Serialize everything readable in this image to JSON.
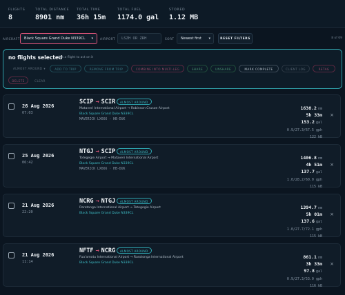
{
  "stats": [
    {
      "label": "FLIGHTS",
      "value": "8"
    },
    {
      "label": "TOTAL DISTANCE",
      "value": "8901 nm"
    },
    {
      "label": "TOTAL TIME",
      "value": "36h 15m"
    },
    {
      "label": "TOTAL FUEL",
      "value": "1174.0 gal"
    },
    {
      "label": "STORED",
      "value": "1.12 MB"
    }
  ],
  "filters": {
    "aircraft_label": "AIRCRAFT",
    "aircraft_value": "Black Square Grand Duke N339CL",
    "airport_label": "AIRPORT",
    "airport_placeholder": "LSZH OR ZRH",
    "sort_label": "SORT",
    "sort_value": "Newest first",
    "reset_label": "RESET FILTERS",
    "count": "8 of 69"
  },
  "actions": {
    "title": "no flights selected",
    "hint": "tick a flight to act on it",
    "atc_label": "ALMOST AROUND",
    "buttons": [
      "ADD TO TRIP",
      "REMOVE FROM TRIP",
      "COMBINE INTO MULTI-LEG",
      "SHARE",
      "UNSHARE",
      "MARK COMPLETE",
      "CLIENT LOG",
      "RETAG",
      "DELETE",
      "CLEAR"
    ]
  },
  "flights": [
    {
      "date": "26 Aug 2026",
      "time": "07:03",
      "from": "SCIP",
      "to": "SCIR",
      "badge": "ALMOST AROUND",
      "airports": "Mataveri International Airport → Robinson Crusoe Airport",
      "aircraft": "Black Square Grand Duke N339CL",
      "reg": "MAVERICK LX666 · HB-DUK",
      "distance": "1638.2",
      "distance_unit": "nm",
      "duration": "5h 33m",
      "fuel": "153.2",
      "fuel_unit": "gal",
      "fuel_detail": "0.9/27.3/67.5 gph",
      "size": "122 kB"
    },
    {
      "date": "25 Aug 2026",
      "time": "06:42",
      "from": "NTGJ",
      "to": "SCIP",
      "badge": "ALMOST AROUND",
      "airports": "Totegegie Airport → Mataveri International Airport",
      "aircraft": "Black Square Grand Duke N339CL",
      "reg": "MAVERICK LX666 · HB-DUK",
      "distance": "1406.8",
      "distance_unit": "nm",
      "duration": "4h 51m",
      "fuel": "137.7",
      "fuel_unit": "gal",
      "fuel_detail": "1.0/28.2/60.0 gph",
      "size": "115 kB"
    },
    {
      "date": "21 Aug 2026",
      "time": "22:20",
      "from": "NCRG",
      "to": "NTGJ",
      "badge": "ALMOST AROUND",
      "airports": "Rarotonga International Airport → Totegegie Airport",
      "aircraft": "Black Square Grand Duke N339CL",
      "reg": "",
      "distance": "1394.7",
      "distance_unit": "nm",
      "duration": "5h 01m",
      "fuel": "137.6",
      "fuel_unit": "gal",
      "fuel_detail": "1.0/27.7/72.1 gph",
      "size": "115 kB"
    },
    {
      "date": "21 Aug 2026",
      "time": "11:14",
      "from": "NFTF",
      "to": "NCRG",
      "badge": "ALMOST AROUND",
      "airports": "Fua'amotu International Airport → Rarotonga International Airport",
      "aircraft": "Black Square Grand Duke N339CL",
      "reg": "",
      "distance": "861.1",
      "distance_unit": "nm",
      "duration": "3h 33m",
      "fuel": "97.8",
      "fuel_unit": "gal",
      "fuel_detail": "0.9/27.3/53.0 gph",
      "size": "116 kB"
    }
  ]
}
